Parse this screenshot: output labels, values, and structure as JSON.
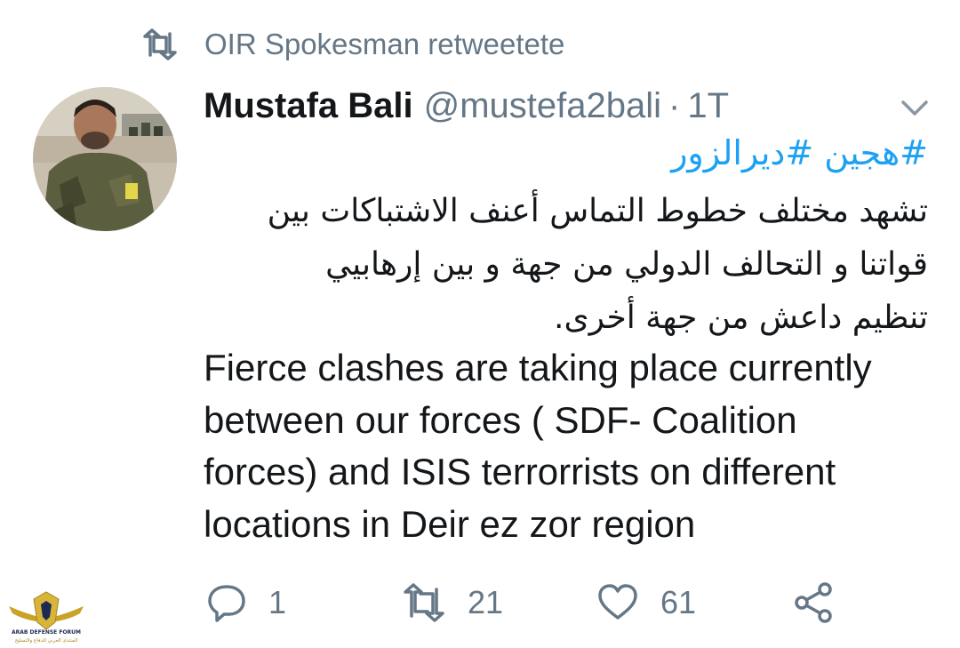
{
  "retweet": {
    "label": "OIR Spokesman retweetete"
  },
  "tweet": {
    "author_name": "Mustafa Bali",
    "handle": "@mustefa2bali",
    "separator": "·",
    "time": "1T",
    "hashtags": [
      "#هجين",
      "#ديرالزور"
    ],
    "arabic_lines": [
      "تشهد مختلف خطوط التماس أعنف الاشتباكات بين",
      "قواتنا و التحالف الدولي من جهة و بين إرهابيي",
      "تنظيم داعش من جهة أخرى."
    ],
    "english_lines": [
      "Fierce clashes are taking place currently",
      "between our forces ( SDF- Coalition",
      "forces) and ISIS terrorrists on different",
      "locations in Deir ez zor region"
    ]
  },
  "actions": {
    "reply_count": "1",
    "retweet_count": "21",
    "like_count": "61"
  },
  "watermark": {
    "logo_text": "DA",
    "name": "ARAB DEFENSE FORUM",
    "arabic_name": "المنتدى العربي للدفاع والتسليح"
  },
  "colors": {
    "text": "#14171a",
    "secondary": "#657786",
    "link": "#1da1f2"
  }
}
